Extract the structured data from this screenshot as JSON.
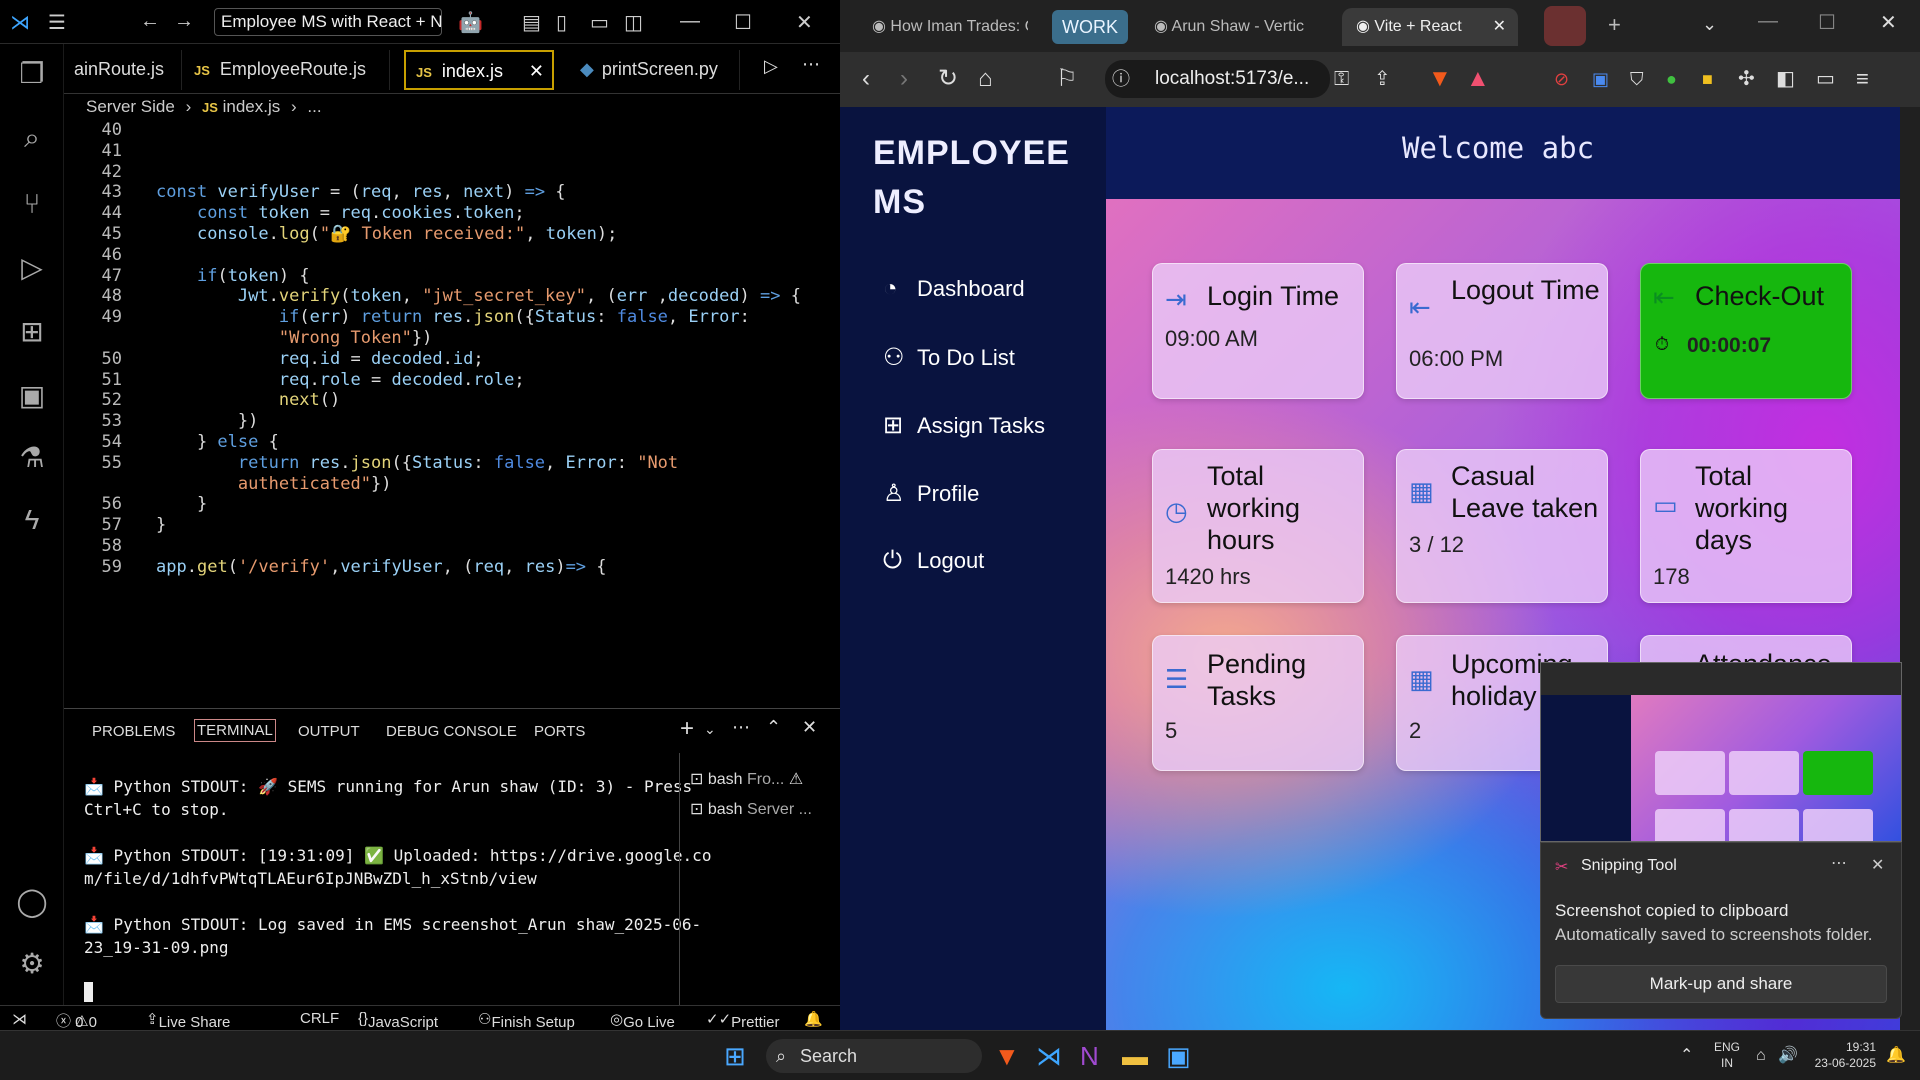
{
  "vscode": {
    "search_text": "Employee MS with React + No",
    "tabs": [
      {
        "label": "ainRoute.js"
      },
      {
        "label": "EmployeeRoute.js",
        "badge": "JS"
      },
      {
        "label": "index.js",
        "badge": "JS"
      },
      {
        "label": "printScreen.py"
      }
    ],
    "breadcrumb": {
      "folder": "Server Side",
      "file": "index.js",
      "more": "..."
    },
    "code_lines": [
      {
        "n": "40",
        "parts": []
      },
      {
        "n": "41",
        "parts": []
      },
      {
        "n": "42",
        "parts": []
      },
      {
        "n": "43",
        "parts": [
          [
            "kw",
            "const "
          ],
          [
            "var",
            "verifyUser"
          ],
          [
            "pun",
            " = ("
          ],
          [
            "var",
            "req"
          ],
          [
            "pun",
            ", "
          ],
          [
            "var",
            "res"
          ],
          [
            "pun",
            ", "
          ],
          [
            "var",
            "next"
          ],
          [
            "pun",
            ") "
          ],
          [
            "kw",
            "=>"
          ],
          [
            "pun",
            " {"
          ]
        ]
      },
      {
        "n": "44",
        "parts": [
          [
            "pun",
            "    "
          ],
          [
            "kw",
            "const "
          ],
          [
            "var",
            "token"
          ],
          [
            "pun",
            " = "
          ],
          [
            "var",
            "req"
          ],
          [
            "pun",
            "."
          ],
          [
            "var",
            "cookies"
          ],
          [
            "pun",
            "."
          ],
          [
            "var",
            "token"
          ],
          [
            "pun",
            ";"
          ]
        ]
      },
      {
        "n": "45",
        "parts": [
          [
            "pun",
            "    "
          ],
          [
            "var",
            "console"
          ],
          [
            "pun",
            "."
          ],
          [
            "fn",
            "log"
          ],
          [
            "pun",
            "("
          ],
          [
            "str",
            "\"🔐 Token received:\""
          ],
          [
            "pun",
            ", "
          ],
          [
            "var",
            "token"
          ],
          [
            "pun",
            ");"
          ]
        ]
      },
      {
        "n": "46",
        "parts": []
      },
      {
        "n": "47",
        "parts": [
          [
            "pun",
            "    "
          ],
          [
            "kw",
            "if"
          ],
          [
            "pun",
            "("
          ],
          [
            "var",
            "token"
          ],
          [
            "pun",
            ") {"
          ]
        ]
      },
      {
        "n": "48",
        "parts": [
          [
            "pun",
            "        "
          ],
          [
            "var",
            "Jwt"
          ],
          [
            "pun",
            "."
          ],
          [
            "fn",
            "verify"
          ],
          [
            "pun",
            "("
          ],
          [
            "var",
            "token"
          ],
          [
            "pun",
            ", "
          ],
          [
            "str",
            "\"jwt_secret_key\""
          ],
          [
            "pun",
            ", ("
          ],
          [
            "var",
            "err"
          ],
          [
            "pun",
            " ,"
          ],
          [
            "var",
            "decoded"
          ],
          [
            "pun",
            ") "
          ],
          [
            "kw",
            "=>"
          ],
          [
            "pun",
            " {"
          ]
        ]
      },
      {
        "n": "49",
        "parts": [
          [
            "pun",
            "            "
          ],
          [
            "kw",
            "if"
          ],
          [
            "pun",
            "("
          ],
          [
            "var",
            "err"
          ],
          [
            "pun",
            ") "
          ],
          [
            "kw",
            "return "
          ],
          [
            "var",
            "res"
          ],
          [
            "pun",
            "."
          ],
          [
            "fn",
            "json"
          ],
          [
            "pun",
            "({"
          ],
          [
            "var",
            "Status"
          ],
          [
            "pun",
            ": "
          ],
          [
            "bool",
            "false"
          ],
          [
            "pun",
            ", "
          ],
          [
            "var",
            "Error"
          ],
          [
            "pun",
            ":"
          ]
        ]
      },
      {
        "n": "",
        "parts": [
          [
            "pun",
            "            "
          ],
          [
            "str",
            "\"Wrong Token\""
          ],
          [
            "pun",
            "})"
          ]
        ]
      },
      {
        "n": "50",
        "parts": [
          [
            "pun",
            "            "
          ],
          [
            "var",
            "req"
          ],
          [
            "pun",
            "."
          ],
          [
            "var",
            "id"
          ],
          [
            "pun",
            " = "
          ],
          [
            "var",
            "decoded"
          ],
          [
            "pun",
            "."
          ],
          [
            "var",
            "id"
          ],
          [
            "pun",
            ";"
          ]
        ]
      },
      {
        "n": "51",
        "parts": [
          [
            "pun",
            "            "
          ],
          [
            "var",
            "req"
          ],
          [
            "pun",
            "."
          ],
          [
            "var",
            "role"
          ],
          [
            "pun",
            " = "
          ],
          [
            "var",
            "decoded"
          ],
          [
            "pun",
            "."
          ],
          [
            "var",
            "role"
          ],
          [
            "pun",
            ";"
          ]
        ]
      },
      {
        "n": "52",
        "parts": [
          [
            "pun",
            "            "
          ],
          [
            "fn",
            "next"
          ],
          [
            "pun",
            "()"
          ]
        ]
      },
      {
        "n": "53",
        "parts": [
          [
            "pun",
            "        })"
          ]
        ]
      },
      {
        "n": "54",
        "parts": [
          [
            "pun",
            "    } "
          ],
          [
            "kw",
            "else"
          ],
          [
            "pun",
            " {"
          ]
        ]
      },
      {
        "n": "55",
        "parts": [
          [
            "pun",
            "        "
          ],
          [
            "kw",
            "return "
          ],
          [
            "var",
            "res"
          ],
          [
            "pun",
            "."
          ],
          [
            "fn",
            "json"
          ],
          [
            "pun",
            "({"
          ],
          [
            "var",
            "Status"
          ],
          [
            "pun",
            ": "
          ],
          [
            "bool",
            "false"
          ],
          [
            "pun",
            ", "
          ],
          [
            "var",
            "Error"
          ],
          [
            "pun",
            ": "
          ],
          [
            "str",
            "\"Not"
          ]
        ]
      },
      {
        "n": "",
        "parts": [
          [
            "pun",
            "        "
          ],
          [
            "str",
            "autheticated\""
          ],
          [
            "pun",
            "})"
          ]
        ]
      },
      {
        "n": "56",
        "parts": [
          [
            "pun",
            "    }"
          ]
        ]
      },
      {
        "n": "57",
        "parts": [
          [
            "pun",
            "}"
          ]
        ]
      },
      {
        "n": "58",
        "parts": []
      },
      {
        "n": "59",
        "parts": [
          [
            "var",
            "app"
          ],
          [
            "pun",
            "."
          ],
          [
            "fn",
            "get"
          ],
          [
            "pun",
            "("
          ],
          [
            "str",
            "'/verify'"
          ],
          [
            "pun",
            ","
          ],
          [
            "var",
            "verifyUser"
          ],
          [
            "pun",
            ", ("
          ],
          [
            "var",
            "req"
          ],
          [
            "pun",
            ", "
          ],
          [
            "var",
            "res"
          ],
          [
            "pun",
            ")"
          ],
          [
            "kw",
            "=>"
          ],
          [
            "pun",
            " {"
          ]
        ]
      }
    ],
    "panel_tabs": [
      "PROBLEMS",
      "TERMINAL",
      "OUTPUT",
      "DEBUG CONSOLE",
      "PORTS"
    ],
    "terminal_lines": [
      "📩 Python STDOUT: 🚀 SEMS running for Arun shaw (ID: 3) - Press Ctrl+C to stop.",
      "📩 Python STDOUT: [19:31:09] ✅ Uploaded: https://drive.google.com/file/d/1dhfvPWtqTLAEur6IpJNBwZDl_h_xStnb/view",
      "📩 Python STDOUT: Log saved in EMS screenshot_Arun shaw_2025-06-23_19-31-09.png"
    ],
    "terminals": [
      {
        "label": "bash",
        "detail": "Fro..."
      },
      {
        "label": "bash",
        "detail": "Server ..."
      }
    ],
    "status": {
      "errors": "0",
      "warnings": "0",
      "live_share": "Live Share",
      "eol": "CRLF",
      "language": "JavaScript",
      "finish_setup": "Finish Setup",
      "go_live": "Go Live",
      "prettier": "Prettier"
    }
  },
  "browser": {
    "tabs": [
      {
        "label": "How Iman Trades: C"
      },
      {
        "label": "Arun Shaw - Vertic"
      },
      {
        "label": "Vite + React"
      }
    ],
    "workspace": "WORK",
    "url": "localhost:5173/e..."
  },
  "app": {
    "brand_line1": "EMPLOYEE",
    "brand_line2": "MS",
    "welcome": "Welcome abc",
    "nav": [
      {
        "label": "Dashboard",
        "icon": "gauge-icon"
      },
      {
        "label": "To Do List",
        "icon": "people-icon"
      },
      {
        "label": "Assign Tasks",
        "icon": "grid-icon"
      },
      {
        "label": "Profile",
        "icon": "person-icon"
      },
      {
        "label": "Logout",
        "icon": "power-icon"
      }
    ],
    "cards": [
      {
        "title": "Login Time",
        "value": "09:00 AM",
        "icon": "login-icon"
      },
      {
        "title": "Logout Time",
        "value": "06:00 PM",
        "icon": "logout-icon"
      },
      {
        "title": "Check-Out",
        "value": "00:00:07",
        "icon": "checkout-icon"
      },
      {
        "title": "Total working hours",
        "value": "1420 hrs",
        "icon": "clock-icon"
      },
      {
        "title": "Casual Leave taken",
        "value": "3 / 12",
        "icon": "calendar-icon"
      },
      {
        "title": "Total working days",
        "value": "178",
        "icon": "briefcase-icon"
      },
      {
        "title": "Pending Tasks",
        "value": "5",
        "icon": "list-icon"
      },
      {
        "title": "Upcoming holiday",
        "value": "2",
        "icon": "calendar-icon"
      },
      {
        "title": "Attendance",
        "value": "",
        "icon": "chart-icon"
      }
    ]
  },
  "snipping": {
    "app": "Snipping Tool",
    "title": "Screenshot copied to clipboard",
    "body": "Automatically saved to screenshots folder.",
    "button": "Mark-up and share"
  },
  "taskbar": {
    "search": "Search",
    "lang_line1": "ENG",
    "lang_line2": "IN",
    "time": "19:31",
    "date": "23-06-2025"
  }
}
